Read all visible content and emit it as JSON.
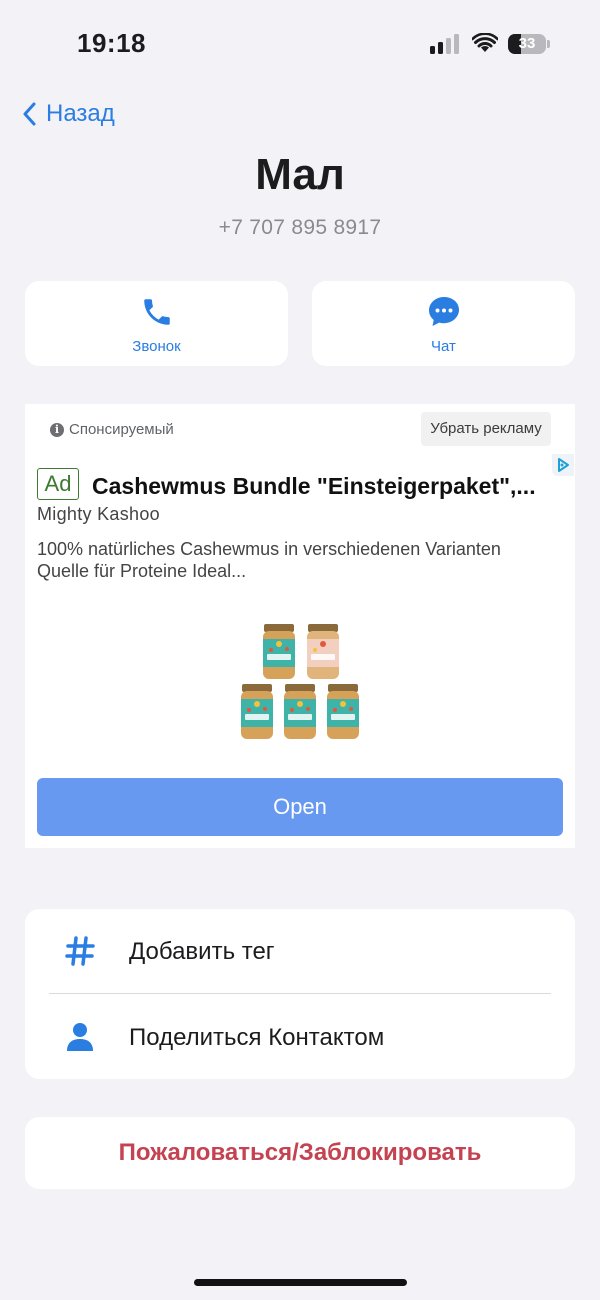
{
  "status_bar": {
    "time": "19:18",
    "battery": "33",
    "battery_level": 0.33
  },
  "nav": {
    "back_label": "Назад"
  },
  "contact": {
    "name": "Мал",
    "phone": "+7 707 895 8917"
  },
  "actions": {
    "call_label": "Звонок",
    "chat_label": "Чат"
  },
  "ad": {
    "sponsored_label": "Спонсируемый",
    "remove_label": "Убрать рекламу",
    "badge": "Ad",
    "title": "Cashewmus Bundle \"Einsteigerpaket\",...",
    "advertiser": "Mighty Kashoo",
    "description": "100% natürliches Cashewmus in verschiedenen Varianten Quelle für Proteine Ideal...",
    "cta_label": "Open",
    "jar_label": "Kashoo"
  },
  "menu": {
    "add_tag_label": "Добавить тег",
    "share_contact_label": "Поделиться Контактом"
  },
  "report_label": "Пожаловаться/Заблокировать",
  "colors": {
    "accent": "#2a7de1",
    "danger": "#c54250",
    "cta": "#6699ef",
    "ad_badge": "#3c7a2e"
  }
}
